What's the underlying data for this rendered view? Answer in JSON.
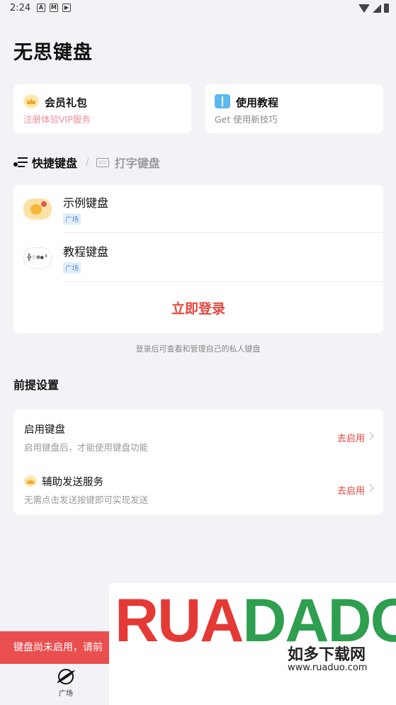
{
  "status_bar": {
    "time": "2:24"
  },
  "app_title": "无思键盘",
  "top_cards": [
    {
      "title": "会员礼包",
      "subtitle": "注册体验VIP服务",
      "subtitle_color": "#f08a9a"
    },
    {
      "title": "使用教程",
      "subtitle": "Get 使用新技巧",
      "subtitle_color": "#888888"
    }
  ],
  "tabs": {
    "active": "快捷键盘",
    "separator": "/",
    "inactive": "打字键盘"
  },
  "keyboards": [
    {
      "title": "示例键盘",
      "badge": "广场"
    },
    {
      "title": "教程键盘",
      "badge": "广场",
      "avatar_text": "╬⁘❄✱³"
    }
  ],
  "login_button": "立即登录",
  "login_hint": "登录后可查看和管理自己的私人键盘",
  "section_title": "前提设置",
  "settings": [
    {
      "title": "启用键盘",
      "subtitle": "启用键盘后，才能使用键盘功能",
      "action": "去启用"
    },
    {
      "title": "辅助发送服务",
      "subtitle": "无需点击发送按键即可实现发送",
      "action": "去启用"
    }
  ],
  "toast": "键盘尚未启用，请前",
  "bottom_nav": {
    "label": "广场"
  },
  "watermark": {
    "logo": "RUADADO",
    "chinese": "如多下载网",
    "url": "www.ruaduo.com"
  },
  "colors": {
    "accent": "#e5453c",
    "background": "#f3f3f7",
    "toast": "#ea4f4f"
  }
}
